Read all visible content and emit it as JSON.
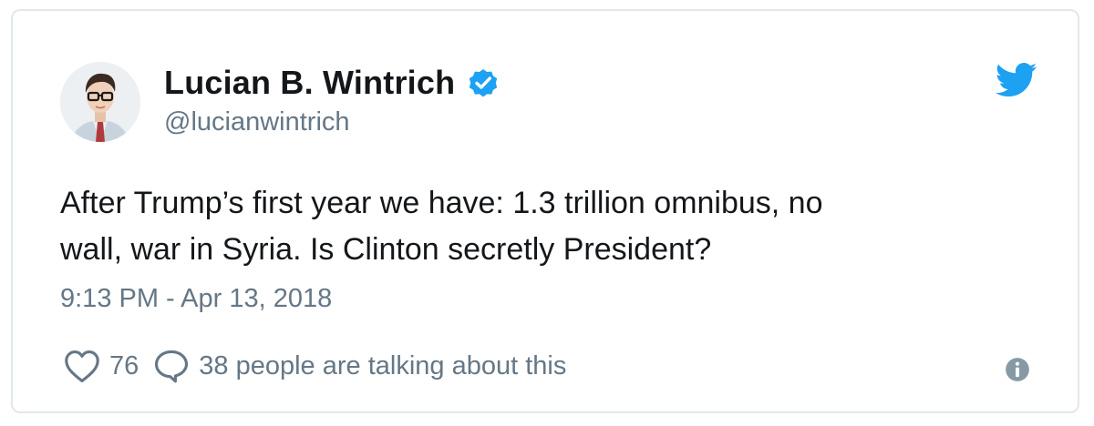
{
  "author": {
    "display_name": "Lucian B. Wintrich",
    "handle": "@lucianwintrich",
    "verified": true
  },
  "tweet": {
    "text_line_1": "After Trump’s first year we have: 1.3 trillion omnibus, no",
    "text_line_2": "wall, war in Syria. Is Clinton secretly President?",
    "timestamp": "9:13 PM - Apr 13, 2018"
  },
  "stats": {
    "likes": "76",
    "talking": "38 people are talking about this"
  },
  "icons": {
    "brand": "twitter-bird-icon",
    "verified": "verified-badge-icon",
    "like": "heart-icon",
    "reply": "speech-bubble-icon",
    "info": "info-icon"
  },
  "colors": {
    "accent": "#1da1f2",
    "text": "#14171a",
    "muted": "#657786",
    "border": "#e1e8ed"
  }
}
